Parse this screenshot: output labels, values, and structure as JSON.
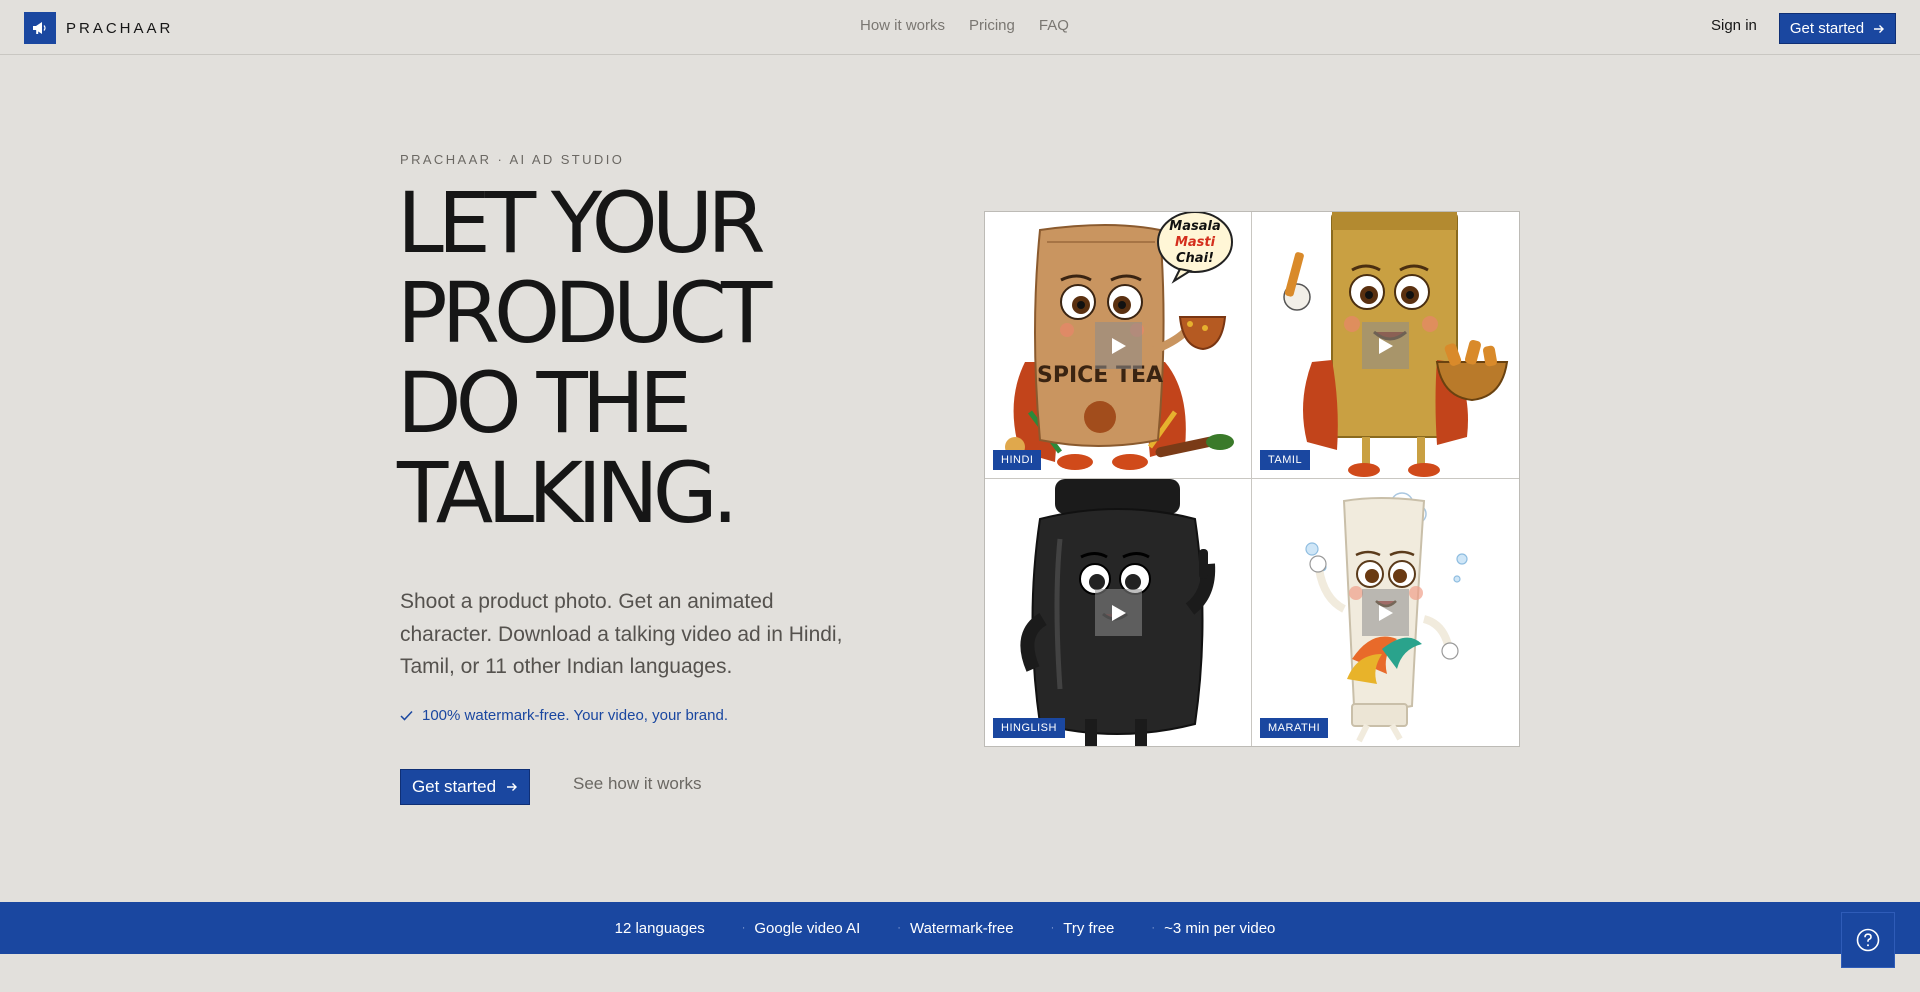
{
  "brand": {
    "name": "PRACHAAR",
    "logo_icon": "megaphone-icon"
  },
  "nav": {
    "links": [
      "How it works",
      "Pricing",
      "FAQ"
    ],
    "signin_label": "Sign in",
    "cta_label": "Get started"
  },
  "hero": {
    "eyebrow": "PRACHAAR · AI AD STUDIO",
    "headline_lines": [
      "LET YOUR",
      "PRODUCT",
      "DO THE",
      "TALKING."
    ],
    "subcopy": "Shoot a product photo. Get an animated character. Download a talking video ad in Hindi, Tamil, or 11 other Indian languages.",
    "check_text": "100% watermark-free. Your video, your brand.",
    "cta_label": "Get started",
    "secondary_label": "See how it works"
  },
  "videos": [
    {
      "language": "HINDI",
      "bubble": [
        "Masala",
        "Masti",
        "Chai!"
      ],
      "pack_text": "SPICE TEA"
    },
    {
      "language": "TAMIL"
    },
    {
      "language": "HINGLISH"
    },
    {
      "language": "MARATHI"
    }
  ],
  "band": {
    "items": [
      "12 languages",
      "Google video AI",
      "Watermark-free",
      "Try free",
      "~3 min per video"
    ]
  },
  "help_icon": "question-circle-icon",
  "colors": {
    "accent": "#1a47a0",
    "background": "#e2e0dc",
    "text": "#161616"
  }
}
